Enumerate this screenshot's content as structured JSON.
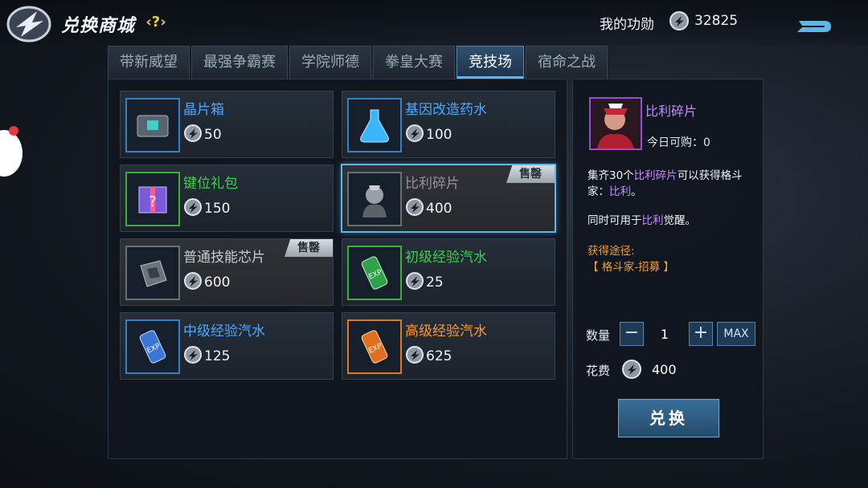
{
  "header": {
    "title": "兑换商城",
    "help": "?",
    "merit_label": "我的功勋",
    "merit_value": "32825"
  },
  "tabs": [
    {
      "label": "带新威望",
      "active": false
    },
    {
      "label": "最强争霸赛",
      "active": false
    },
    {
      "label": "学院师德",
      "active": false
    },
    {
      "label": "拳皇大赛",
      "active": false
    },
    {
      "label": "竞技场",
      "active": true
    },
    {
      "label": "宿命之战",
      "active": false
    }
  ],
  "items": [
    {
      "name": "晶片箱",
      "cost": "50",
      "name_color": "#4aa8ff",
      "icon": "chip-box-icon",
      "soldout": false
    },
    {
      "name": "基因改造药水",
      "cost": "100",
      "name_color": "#4aa8ff",
      "icon": "gene-potion-icon",
      "soldout": false
    },
    {
      "name": "键位礼包",
      "cost": "150",
      "name_color": "#3fd04a",
      "icon": "gift-box-icon",
      "soldout": false
    },
    {
      "name": "比利碎片",
      "cost": "400",
      "name_color": "#8f959c",
      "icon": "billy-fragment-icon",
      "soldout": true,
      "selected": true
    },
    {
      "name": "普通技能芯片",
      "cost": "600",
      "name_color": "#c6cbd1",
      "icon": "skill-chip-icon",
      "soldout": true
    },
    {
      "name": "初级经验汽水",
      "cost": "25",
      "name_color": "#3fd04a",
      "icon": "exp-soda-green-icon",
      "soldout": false
    },
    {
      "name": "中级经验汽水",
      "cost": "125",
      "name_color": "#4aa8ff",
      "icon": "exp-soda-blue-icon",
      "soldout": false
    },
    {
      "name": "高级经验汽水",
      "cost": "625",
      "name_color": "#ff9a2e",
      "icon": "exp-soda-orange-icon",
      "soldout": false
    }
  ],
  "sold_label": "售罄",
  "detail": {
    "name": "比利碎片",
    "today": "今日可购：0",
    "desc_prefix": "集齐30个",
    "desc_item": "比利碎片",
    "desc_mid": "可以获得格斗家：",
    "desc_char": "比利",
    "desc_end": "。",
    "use_prefix": "同时可用于",
    "use_char": "比利",
    "use_end": "觉醒。",
    "source_label": "获得途径:",
    "source": "【 格斗家-招募 】",
    "qty_label": "数量",
    "qty_minus": "−",
    "qty_value": "1",
    "qty_plus": "+",
    "max_label": "MAX",
    "cost_label": "花费",
    "cost_value": "400",
    "exchange_label": "兑换"
  },
  "colors": {
    "accent": "#5fb6e8",
    "purple": "#c58bff",
    "orange": "#f0a030"
  }
}
